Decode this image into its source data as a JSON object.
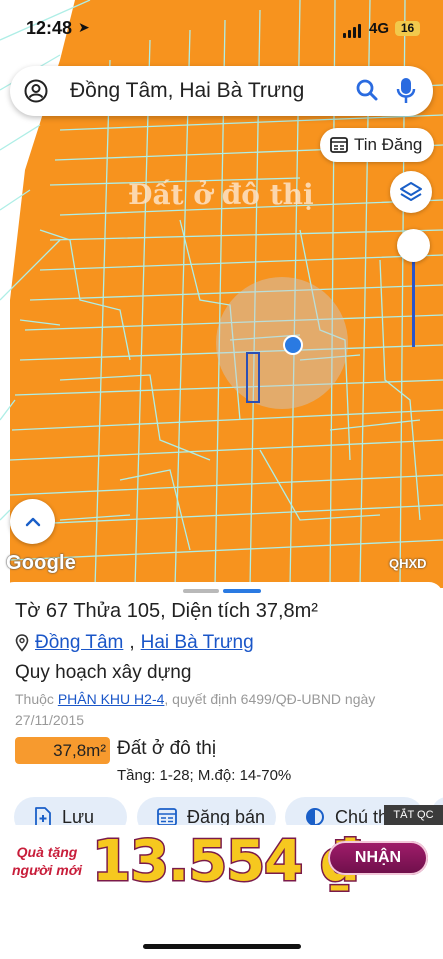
{
  "status_bar": {
    "time": "12:48",
    "network": "4G",
    "battery": "16"
  },
  "search": {
    "query": "Đồng Tâm, Hai Bà Trưng"
  },
  "map": {
    "land_label": "Đất ở đô thị",
    "tin_dang_label": "Tin Đăng",
    "google_logo": "Google",
    "qhxd_label": "QHXD",
    "colors": {
      "zone": "#f7931e",
      "parcel_lines": "#aeeee6",
      "selected": "#2b4fb5"
    }
  },
  "sheet": {
    "title": "Tờ 67 Thửa 105, Diện tích 37,8m²",
    "address": {
      "part1": "Đồng Tâm",
      "separator": ",",
      "part2": "Hai Bà Trưng"
    },
    "quy_hoach": "Quy hoạch xây dựng",
    "thuoc_prefix": "Thuộc",
    "phan_khu": "PHÂN KHU H2-4",
    "decision": ", quyết định 6499/QĐ-UBND ngày 27/11/2015",
    "area": "37,8m²",
    "land_type": "Đất ở đô thị",
    "floors": "Tầng: 1-28; M.độ: 14-70%",
    "buttons": {
      "save": "Lưu",
      "post": "Đăng bán",
      "legend": "Chú thích"
    }
  },
  "ad": {
    "close_label": "TẮT QC",
    "gift_line1": "Quà tặng",
    "gift_line2": "người mới",
    "amount": "13.554 ₫",
    "cta": "NHẬN"
  }
}
